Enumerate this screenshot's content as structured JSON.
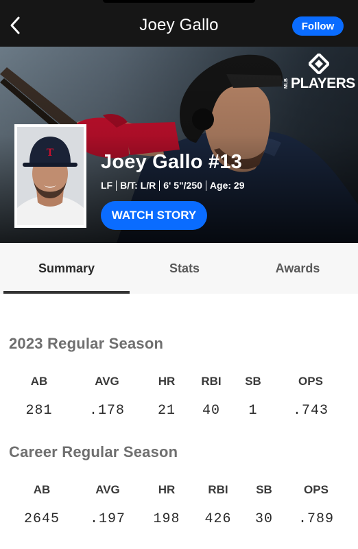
{
  "nav": {
    "title": "Joey Gallo",
    "follow_label": "Follow"
  },
  "hero": {
    "logo_text": "PLAYERS",
    "logo_small_text": "MLB",
    "player_name": "Joey Gallo #13",
    "position": "LF",
    "bats_throws": "B/T: L/R",
    "height_weight": "6' 5\"/250",
    "age": "Age: 29",
    "watch_label": "WATCH STORY"
  },
  "tabs": [
    {
      "label": "Summary",
      "active": true
    },
    {
      "label": "Stats",
      "active": false
    },
    {
      "label": "Awards",
      "active": false
    }
  ],
  "season": {
    "title": "2023 Regular Season",
    "headers": [
      "AB",
      "AVG",
      "HR",
      "RBI",
      "SB",
      "OPS"
    ],
    "values": [
      "281",
      ".178",
      "21",
      "40",
      "1",
      ".743"
    ]
  },
  "career": {
    "title": "Career Regular Season",
    "headers": [
      "AB",
      "AVG",
      "HR",
      "RBI",
      "SB",
      "OPS"
    ],
    "values": [
      "2645",
      ".197",
      "198",
      "426",
      "30",
      ".789"
    ]
  },
  "colors": {
    "accent": "#0a6cff",
    "topbar": "#161616",
    "tab_bg": "#f7f7f7"
  },
  "icons": {
    "back": "chevron-left-icon",
    "logo": "mlb-players-logo"
  }
}
